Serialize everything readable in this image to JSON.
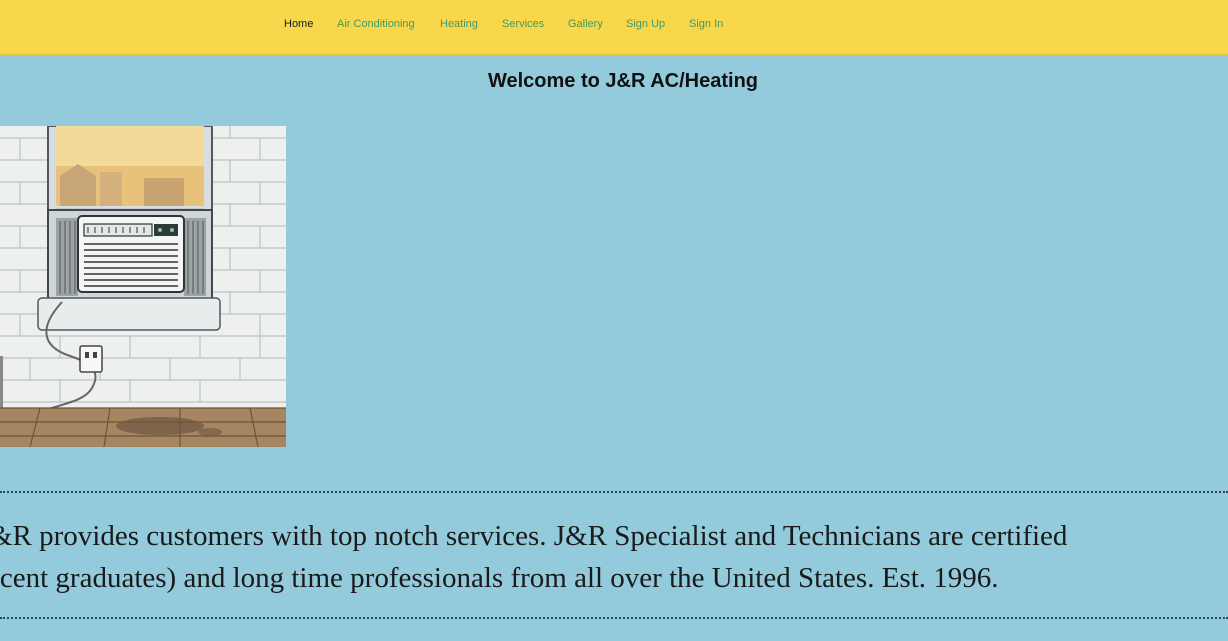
{
  "nav": {
    "items": [
      {
        "label": "Home",
        "active": true
      },
      {
        "label": "Air Conditioning",
        "active": false
      },
      {
        "label": "Heating",
        "active": false
      },
      {
        "label": "Services",
        "active": false
      },
      {
        "label": "Gallery",
        "active": false
      },
      {
        "label": "Sign Up",
        "active": false
      },
      {
        "label": "Sign In",
        "active": false
      }
    ]
  },
  "main": {
    "title": "Welcome to J&R AC/Heating",
    "about_lines": [
      "&R provides customers with top notch services. J&R Specialist and Technicians are certified",
      "ecent graduates) and long time professionals from all over the United States. Est. 1996."
    ]
  },
  "colors": {
    "navbar_bg": "#f8d84a",
    "page_bg": "#93cbdc",
    "nav_link": "#3f9a6a",
    "nav_active": "#1b1b1b"
  },
  "icons": {
    "hero_image": "window-air-conditioner-illustration"
  }
}
